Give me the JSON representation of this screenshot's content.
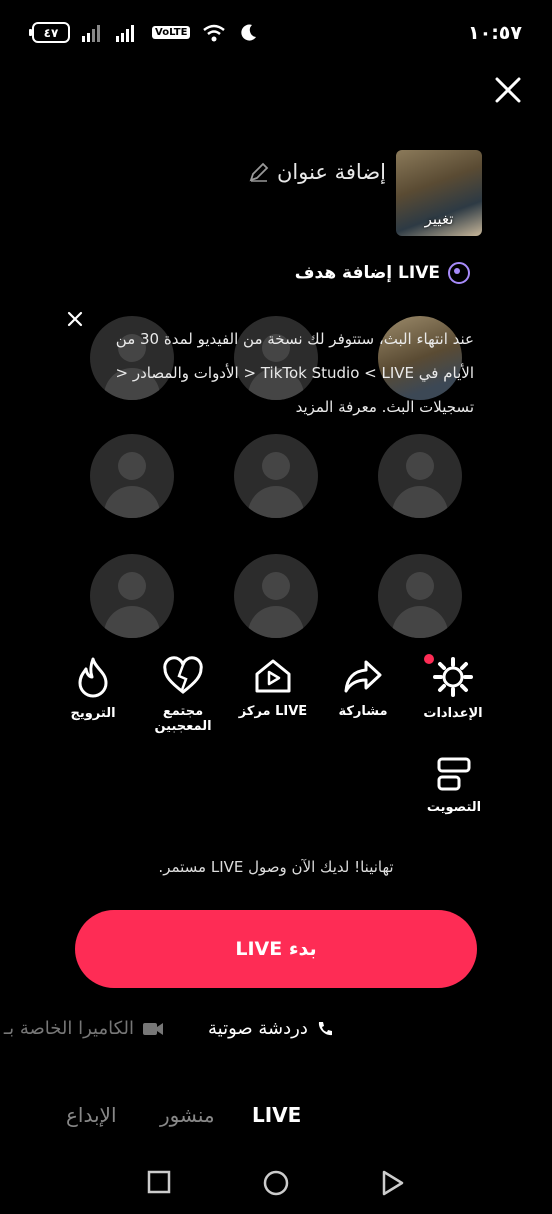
{
  "status_bar": {
    "time": "١٠:٥٧",
    "battery": "٤٧",
    "volte": "VoLTE"
  },
  "header": {
    "close_icon": "close-icon"
  },
  "setup": {
    "cover_label": "تغيير",
    "add_title": "إضافة عنوان",
    "goal": "إضافة هدف LIVE"
  },
  "notice": {
    "line1": "عند انتهاء البث، ستتوفر لك نسخة من الفيديو لمدة 30 من",
    "line2": "الأيام في TikTok Studio < LIVE < الأدوات والمصادر <",
    "line3": "تسجيلات البث. معرفة المزيد"
  },
  "actions": [
    {
      "label": "الترويج",
      "icon": "flame-icon"
    },
    {
      "label": "مجتمع المعجبين",
      "icon": "heart-icon"
    },
    {
      "label": "مركز LIVE",
      "icon": "live-center-icon"
    },
    {
      "label": "مشاركة",
      "icon": "share-icon"
    },
    {
      "label": "الإعدادات",
      "icon": "settings-icon"
    }
  ],
  "poll": {
    "label": "التصويت",
    "icon": "poll-icon"
  },
  "congrats": "تهانينا! لديك الآن وصول LIVE مستمر.",
  "go_live": "بدء LIVE",
  "modes": {
    "voice": "دردشة صوتية",
    "camera": "الكاميرا الخاصة بـ"
  },
  "tabs": {
    "create": "الإبداع",
    "post": "منشور",
    "live": "LIVE"
  },
  "colors": {
    "accent": "#fe2c55",
    "goal": "#a78bfa"
  }
}
